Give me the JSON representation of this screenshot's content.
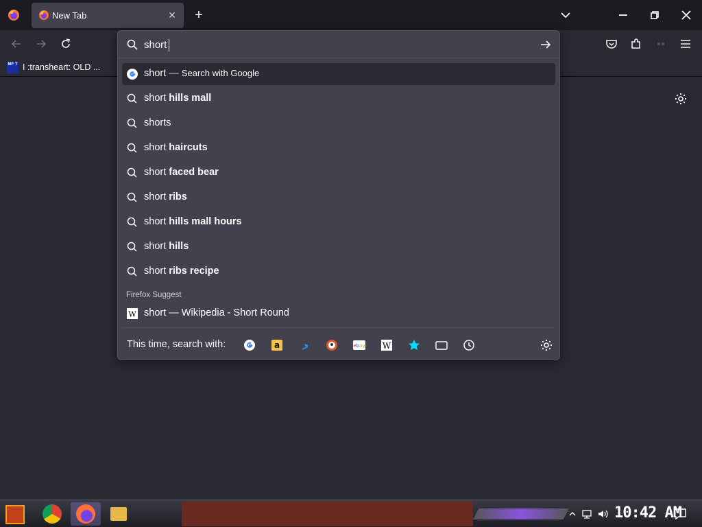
{
  "window": {
    "tab_title": "New Tab",
    "new_tab_symbol": "+",
    "close_symbol": "✕"
  },
  "toolbar": {
    "back_icon": "back-arrow-icon",
    "forward_icon": "forward-arrow-icon",
    "reload_icon": "reload-icon"
  },
  "bookmarks": [
    {
      "label": "I :transheart: OLD ...",
      "icon_text": "MF T"
    }
  ],
  "urlbar": {
    "value": "short"
  },
  "results": [
    {
      "type": "search-engine",
      "prefix": "short",
      "separator": " — ",
      "suffix": "Search with Google",
      "selected": true
    },
    {
      "type": "search",
      "prefix": "short ",
      "bold": "hills mall"
    },
    {
      "type": "search",
      "prefix": "short",
      "bold": "s"
    },
    {
      "type": "search",
      "prefix": "short ",
      "bold": "haircuts"
    },
    {
      "type": "search",
      "prefix": "short ",
      "bold": "faced bear"
    },
    {
      "type": "search",
      "prefix": "short ",
      "bold": "ribs"
    },
    {
      "type": "search",
      "prefix": "short ",
      "bold": "hills mall hours"
    },
    {
      "type": "search",
      "prefix": "short ",
      "bold": "hills"
    },
    {
      "type": "search",
      "prefix": "short ",
      "bold": "ribs recipe"
    }
  ],
  "firefox_suggest": {
    "label": "Firefox Suggest",
    "item": "short — Wikipedia - Short Round"
  },
  "search_with": {
    "label": "This time, search with:",
    "engines": [
      "google-icon",
      "amazon-icon",
      "bing-icon",
      "duckduckgo-icon",
      "ebay-icon",
      "wikipedia-icon",
      "bookmarks-star-icon",
      "tabs-icon",
      "history-clock-icon"
    ]
  },
  "taskbar": {
    "clock": "10:42 AM"
  },
  "colors": {
    "background": "#2b2a33",
    "popup": "#42414d",
    "tabbar": "#1c1b22",
    "accent": "#00ddff"
  }
}
